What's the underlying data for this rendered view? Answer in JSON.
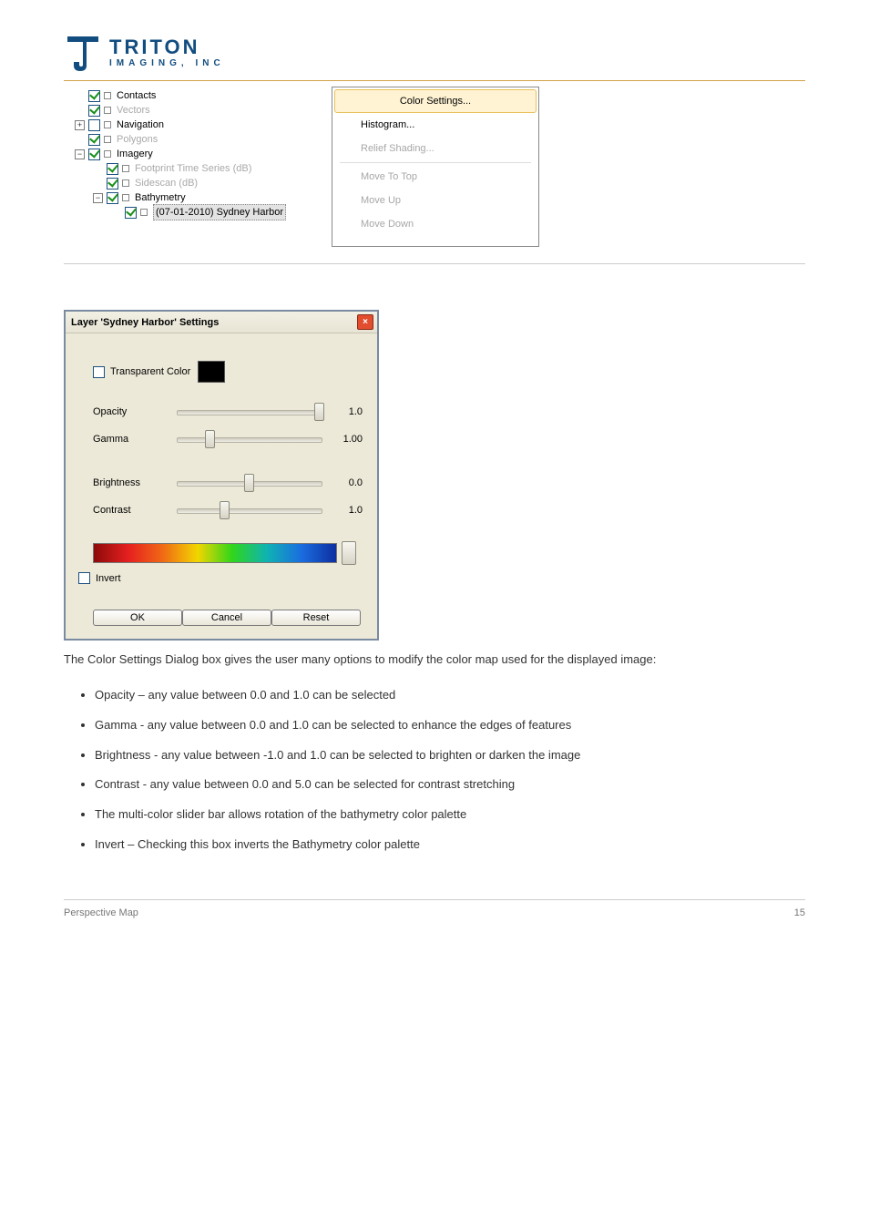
{
  "logo": {
    "line1": "TRITON",
    "line2": "IMAGING, INC"
  },
  "tree": {
    "items": [
      {
        "indent": 0,
        "expander": " ",
        "checked": true,
        "label": "Contacts",
        "dim": false
      },
      {
        "indent": 0,
        "expander": " ",
        "checked": true,
        "label": "Vectors",
        "dim": true
      },
      {
        "indent": 0,
        "expander": "+",
        "checked": false,
        "label": "Navigation",
        "dim": false
      },
      {
        "indent": 0,
        "expander": " ",
        "checked": true,
        "label": "Polygons",
        "dim": true
      },
      {
        "indent": 0,
        "expander": "−",
        "checked": true,
        "label": "Imagery",
        "dim": false
      },
      {
        "indent": 1,
        "expander": " ",
        "checked": true,
        "label": "Footprint Time Series (dB)",
        "dim": true
      },
      {
        "indent": 1,
        "expander": " ",
        "checked": true,
        "label": "Sidescan (dB)",
        "dim": true
      },
      {
        "indent": 1,
        "expander": "−",
        "checked": true,
        "label": "Bathymetry",
        "dim": false
      },
      {
        "indent": 2,
        "expander": " ",
        "checked": true,
        "label": "(07-01-2010) Sydney Harbor",
        "dim": false,
        "selected": true
      }
    ]
  },
  "context_menu": {
    "items": [
      {
        "label": "Color Settings...",
        "disabled": false,
        "highlight": true
      },
      {
        "label": "Histogram...",
        "disabled": false
      },
      {
        "label": "Relief Shading...",
        "disabled": true
      },
      {
        "sep": true
      },
      {
        "label": "Move To Top",
        "disabled": true
      },
      {
        "label": "Move Up",
        "disabled": true
      },
      {
        "label": "Move Down",
        "disabled": true
      }
    ]
  },
  "dialog": {
    "title": "Layer 'Sydney Harbor' Settings",
    "transparent_label": "Transparent Color",
    "rows": {
      "opacity": {
        "label": "Opacity",
        "value": "1.0",
        "pos": 0.98
      },
      "gamma": {
        "label": "Gamma",
        "value": "1.00",
        "pos": 0.23
      },
      "brightness": {
        "label": "Brightness",
        "value": "0.0",
        "pos": 0.5
      },
      "contrast": {
        "label": "Contrast",
        "value": "1.0",
        "pos": 0.33
      }
    },
    "invert_label": "Invert",
    "buttons": {
      "ok": "OK",
      "cancel": "Cancel",
      "reset": "Reset"
    }
  },
  "paragraph": "The Color Settings Dialog box gives the user many options to modify the color map used for the displayed image:",
  "bullets": [
    "Opacity – any value between 0.0 and 1.0 can be selected",
    "Gamma - any value between 0.0 and 1.0 can be selected to enhance the edges of features",
    "Brightness - any value between -1.0 and 1.0 can be selected to brighten or darken the image",
    "Contrast - any value between 0.0 and 5.0 can be selected for contrast stretching",
    "The multi-color slider bar allows rotation of the bathymetry color palette",
    "Invert – Checking this box inverts the Bathymetry color palette"
  ],
  "footer": {
    "left": "Perspective Map",
    "right": "15"
  }
}
